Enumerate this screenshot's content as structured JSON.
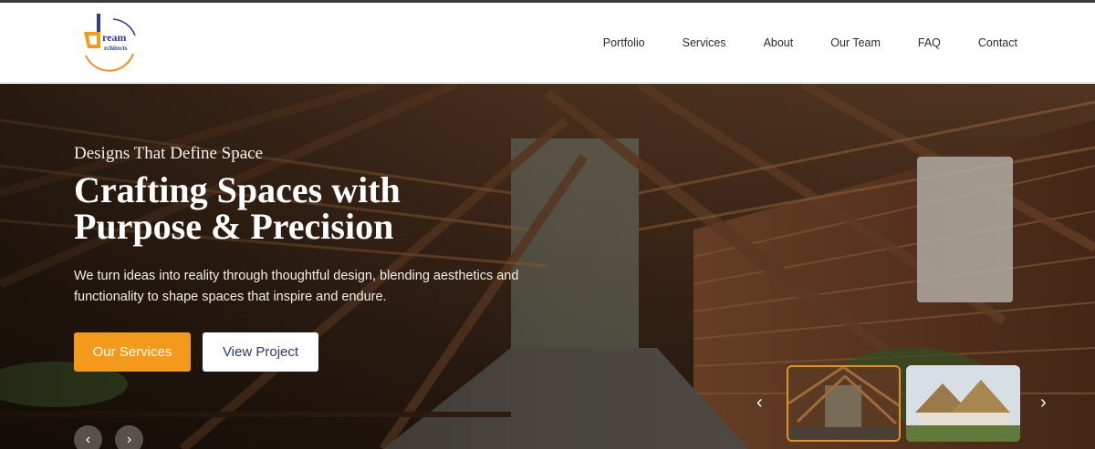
{
  "brand": {
    "logo_text_line1": "ream",
    "logo_text_line2": "rchitects",
    "accent": "#f39a1c"
  },
  "nav": {
    "items": [
      {
        "label": "Portfolio"
      },
      {
        "label": "Services"
      },
      {
        "label": "About"
      },
      {
        "label": "Our Team"
      },
      {
        "label": "FAQ"
      },
      {
        "label": "Contact"
      }
    ]
  },
  "hero": {
    "kicker": "Designs That Define Space",
    "headline": "Crafting Spaces with Purpose & Precision",
    "description": "We turn ideas into reality through thoughtful design, blending aesthetics and functionality to shape spaces that inspire and endure.",
    "primary_button": "Our Services",
    "secondary_button": "View Project",
    "prev_icon": "chevron-left-icon",
    "next_icon": "chevron-right-icon",
    "background_image": "timber-pavilion-interior-photo"
  },
  "carousel": {
    "thumbnails": [
      {
        "image": "timber-pavilion-interior",
        "active": true
      },
      {
        "image": "thatched-roof-building",
        "active": false
      }
    ],
    "prev_glyph": "‹",
    "next_glyph": "›"
  },
  "slider_nav": {
    "prev_glyph": "‹",
    "next_glyph": "›"
  }
}
